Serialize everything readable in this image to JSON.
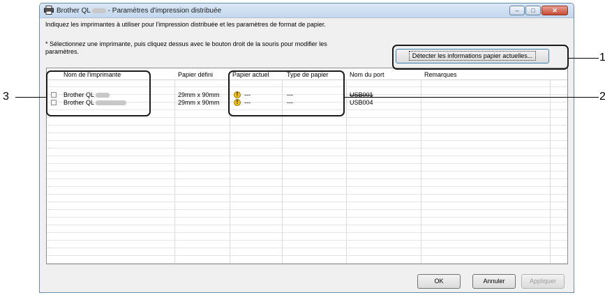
{
  "window": {
    "title_prefix": "Brother QL",
    "title_suffix": " - Paramètres d'impression distribuée",
    "controls": {
      "minimize": "‒",
      "maximize": "□",
      "close": "✕"
    },
    "icon": "printer-icon"
  },
  "instructions": "Indiquez les imprimantes à utiliser pour l'impression distribuée et les paramètres de format de papier.",
  "note": "* Sélectionnez une imprimante, puis cliquez dessus avec le bouton droit de la souris pour modifier les paramètres.",
  "detect_button": "Détecter les informations papier actuelles...",
  "table": {
    "headers": [
      "Nom de l'imprimante",
      "Papier défini",
      "Papier actuel",
      "Type de papier",
      "Nom du port",
      "Remarques"
    ],
    "rows": [
      {
        "name_prefix": "Brother QL",
        "name_suffix": "",
        "paper_defined": "29mm x 90mm",
        "current_paper": "---",
        "paper_type": "---",
        "port": "USB001",
        "remarks": ""
      },
      {
        "name_prefix": "Brother QL",
        "name_suffix": "",
        "paper_defined": "29mm x 90mm",
        "current_paper": "---",
        "paper_type": "---",
        "port": "USB004",
        "remarks": ""
      }
    ]
  },
  "buttons": {
    "ok": "OK",
    "cancel": "Annuler",
    "apply": "Appliquer"
  },
  "callouts": [
    "1",
    "2",
    "3"
  ],
  "colors": {
    "callout": "#1a1a1a",
    "warning": "#f3c21a",
    "accent": "#3c7fb1"
  }
}
